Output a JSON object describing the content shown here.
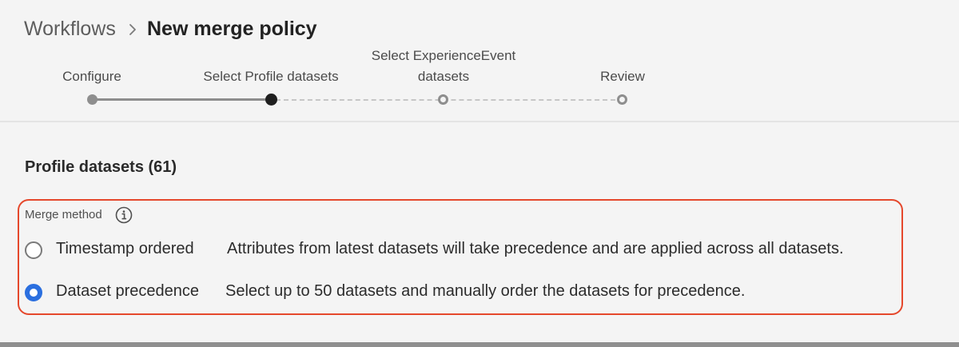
{
  "breadcrumb": {
    "root": "Workflows",
    "current": "New merge policy"
  },
  "stepper": {
    "steps": [
      {
        "label": "Configure",
        "state": "complete"
      },
      {
        "label": "Select Profile datasets",
        "state": "current"
      },
      {
        "label": "Select ExperienceEvent datasets",
        "label_line1": "Select ExperienceEvent",
        "label_line2": "datasets",
        "state": "pending"
      },
      {
        "label": "Review",
        "state": "pending"
      }
    ]
  },
  "section": {
    "title": "Profile datasets (61)"
  },
  "merge_method": {
    "label": "Merge method",
    "info_icon": "info-icon",
    "options": [
      {
        "label": "Timestamp ordered",
        "description": "Attributes from latest datasets will take precedence and are applied across all datasets.",
        "selected": false
      },
      {
        "label": "Dataset precedence",
        "description": "Select up to 50 datasets and manually order the datasets for precedence.",
        "selected": true
      }
    ]
  },
  "colors": {
    "accent": "#2b6fdf",
    "highlight_border": "#e5482c",
    "background": "#f4f4f4"
  }
}
